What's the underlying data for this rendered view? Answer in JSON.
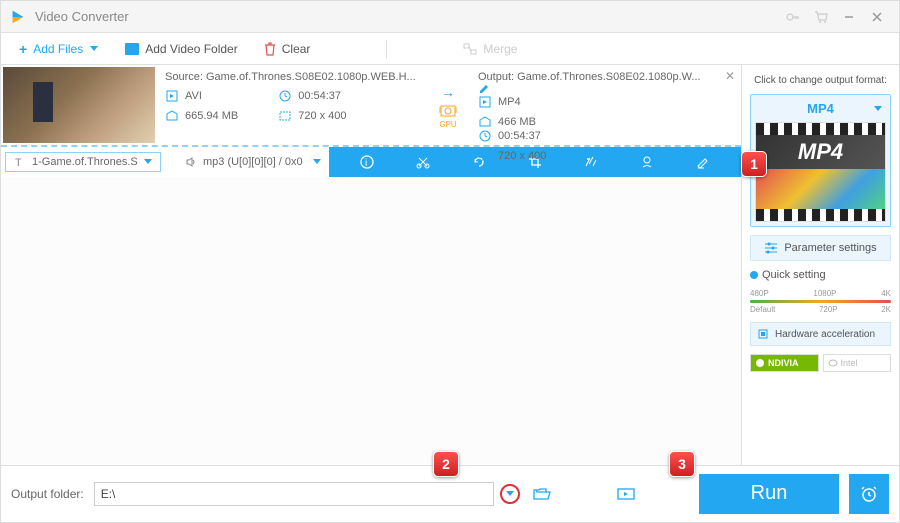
{
  "app": {
    "title": "Video Converter"
  },
  "toolbar": {
    "add_files": "Add Files",
    "add_video_folder": "Add Video Folder",
    "clear": "Clear",
    "merge": "Merge"
  },
  "item": {
    "source_label": "Source:",
    "source_name": "Game.of.Thrones.S08E02.1080p.WEB.H...",
    "src_format": "AVI",
    "src_duration": "00:54:37",
    "src_size": "665.94 MB",
    "src_res": "720 x 400",
    "gpu_label": "GPU",
    "output_label": "Output:",
    "output_name": "Game.of.Thrones.S08E02.1080p.W...",
    "out_format": "MP4",
    "out_duration": "00:54:37",
    "out_size": "466 MB",
    "out_res": "720 x 400"
  },
  "tracks": {
    "video_track": "1-Game.of.Thrones.S",
    "audio_track": "mp3 (U[0][0][0] / 0x0"
  },
  "right": {
    "hint": "Click to change output format:",
    "format_label": "MP4",
    "preview_text": "MP4",
    "param_settings": "Parameter settings",
    "quick_setting": "Quick setting",
    "ticks_top": [
      "480P",
      "1080P",
      "4K"
    ],
    "ticks_bottom": [
      "Default",
      "720P",
      "2K"
    ],
    "hw_accel": "Hardware acceleration",
    "nvidia": "NDIVIA",
    "intel": "Intel"
  },
  "bottom": {
    "output_folder_label": "Output folder:",
    "output_folder_value": "E:\\",
    "run": "Run"
  },
  "callouts": {
    "c1": "1",
    "c2": "2",
    "c3": "3"
  }
}
